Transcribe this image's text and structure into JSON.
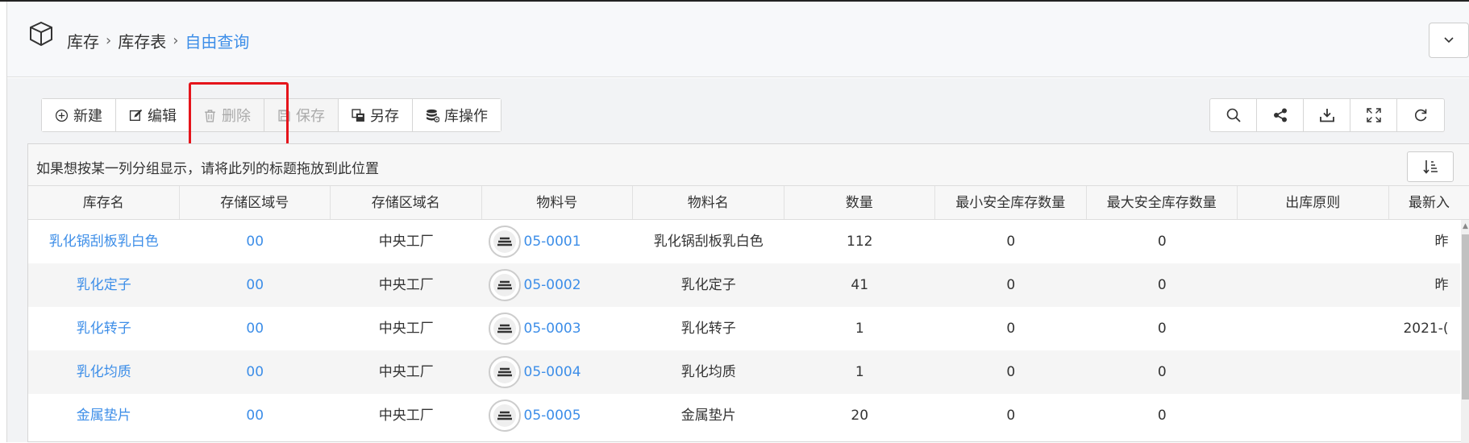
{
  "breadcrumb": {
    "items": [
      "库存",
      "库存表"
    ],
    "current": "自由查询",
    "separator": "›"
  },
  "toolbar": {
    "new_label": "新建",
    "edit_label": "编辑",
    "delete_label": "删除",
    "save_label": "保存",
    "saveas_label": "另存",
    "stockop_label": "库操作"
  },
  "grid": {
    "group_hint": "如果想按某一列分组显示，请将此列的标题拖放到此位置",
    "columns": [
      "库存名",
      "存储区域号",
      "存储区域名",
      "物料号",
      "物料名",
      "数量",
      "最小安全库存数量",
      "最大安全库存数量",
      "出库原则",
      "最新入"
    ],
    "rows": [
      {
        "name": "乳化锅刮板乳白色",
        "area_no": "00",
        "area_name": "中央工厂",
        "material_no": "05-0001",
        "material_name": "乳化锅刮板乳白色",
        "qty": "112",
        "min_qty": "0",
        "max_qty": "0",
        "principle": "",
        "latest": "昨"
      },
      {
        "name": "乳化定子",
        "area_no": "00",
        "area_name": "中央工厂",
        "material_no": "05-0002",
        "material_name": "乳化定子",
        "qty": "41",
        "min_qty": "0",
        "max_qty": "0",
        "principle": "",
        "latest": "昨"
      },
      {
        "name": "乳化转子",
        "area_no": "00",
        "area_name": "中央工厂",
        "material_no": "05-0003",
        "material_name": "乳化转子",
        "qty": "1",
        "min_qty": "0",
        "max_qty": "0",
        "principle": "",
        "latest": "2021-("
      },
      {
        "name": "乳化均质",
        "area_no": "00",
        "area_name": "中央工厂",
        "material_no": "05-0004",
        "material_name": "乳化均质",
        "qty": "1",
        "min_qty": "0",
        "max_qty": "0",
        "principle": "",
        "latest": ""
      },
      {
        "name": "金属垫片",
        "area_no": "00",
        "area_name": "中央工厂",
        "material_no": "05-0005",
        "material_name": "金属垫片",
        "qty": "20",
        "min_qty": "0",
        "max_qty": "0",
        "principle": "",
        "latest": ""
      }
    ]
  },
  "colors": {
    "link": "#3d8ee8",
    "highlight": "#e5141b",
    "disabled_text": "#aaaaaa"
  }
}
